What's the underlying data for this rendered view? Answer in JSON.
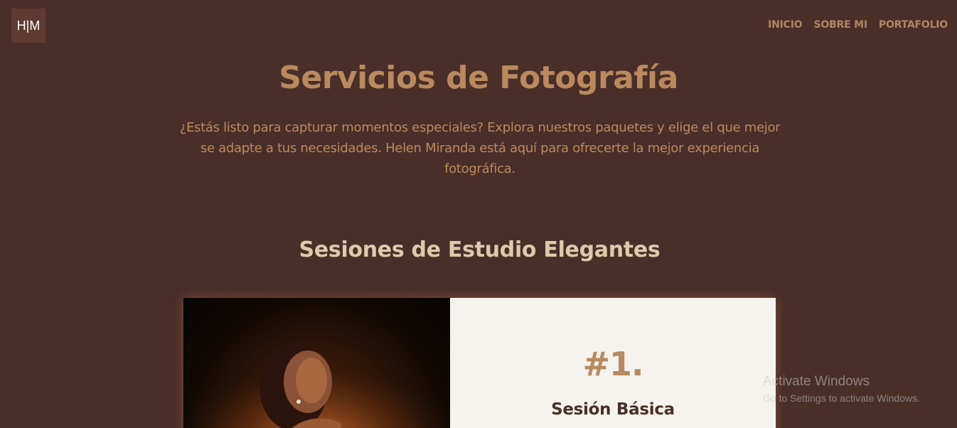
{
  "logo": {
    "text": "H|M"
  },
  "nav": {
    "items": [
      {
        "label": "INICIO"
      },
      {
        "label": "SOBRE MI"
      },
      {
        "label": "PORTAFOLIO"
      }
    ]
  },
  "hero": {
    "title": "Servicios de Fotografía",
    "text_lines": [
      "¿Estás listo para capturar momentos especiales? Explora nuestros paquetes y elige el que mejor",
      "se adapte a tus necesidades. Helen Miranda está aquí para ofrecerte la mejor experiencia",
      "fotográfica."
    ]
  },
  "section": {
    "title": "Sesiones de Estudio Elegantes"
  },
  "cards": [
    {
      "number": "#1.",
      "name": "Sesión Básica"
    }
  ],
  "watermark": {
    "line1": "Activate Windows",
    "line2": "Go to Settings to activate Windows."
  },
  "colors": {
    "background": "#4a2e28",
    "accent": "#b98a5f",
    "section_title": "#e0c8ab",
    "card_bg": "#f6f2ee"
  }
}
